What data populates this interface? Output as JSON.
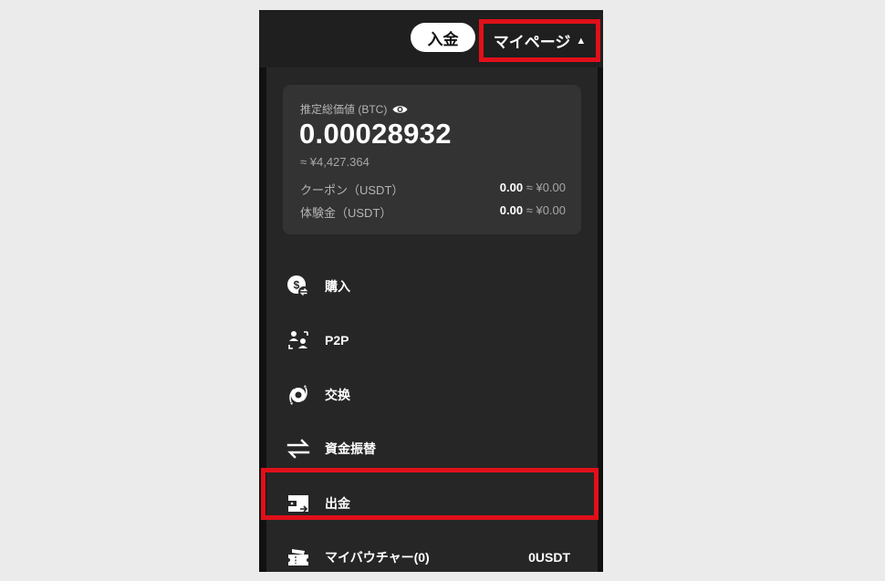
{
  "header": {
    "deposit_label": "入金",
    "mypage_label": "マイページ",
    "mypage_caret": "▲"
  },
  "balance": {
    "label": "推定総価値 (BTC)",
    "amount": "0.00028932",
    "approx": "≈ ¥4,427.364",
    "rows": [
      {
        "label": "クーポン（USDT）",
        "value": "0.00",
        "approx": "≈ ¥0.00"
      },
      {
        "label": "体験金（USDT）",
        "value": "0.00",
        "approx": "≈ ¥0.00"
      }
    ]
  },
  "menu": {
    "items": [
      {
        "label": "購入",
        "icon": "dollar-exchange-icon"
      },
      {
        "label": "P2P",
        "icon": "p2p-users-icon"
      },
      {
        "label": "交换",
        "icon": "swap-coin-icon"
      },
      {
        "label": "資金振替",
        "icon": "transfer-arrows-icon"
      },
      {
        "label": "出金",
        "icon": "withdraw-wallet-icon"
      },
      {
        "label": "マイバウチャー(0)",
        "icon": "voucher-ticket-icon",
        "value": "0USDT"
      }
    ]
  },
  "colors": {
    "highlight": "#e0101a",
    "background": "#262626",
    "card": "#333333"
  }
}
